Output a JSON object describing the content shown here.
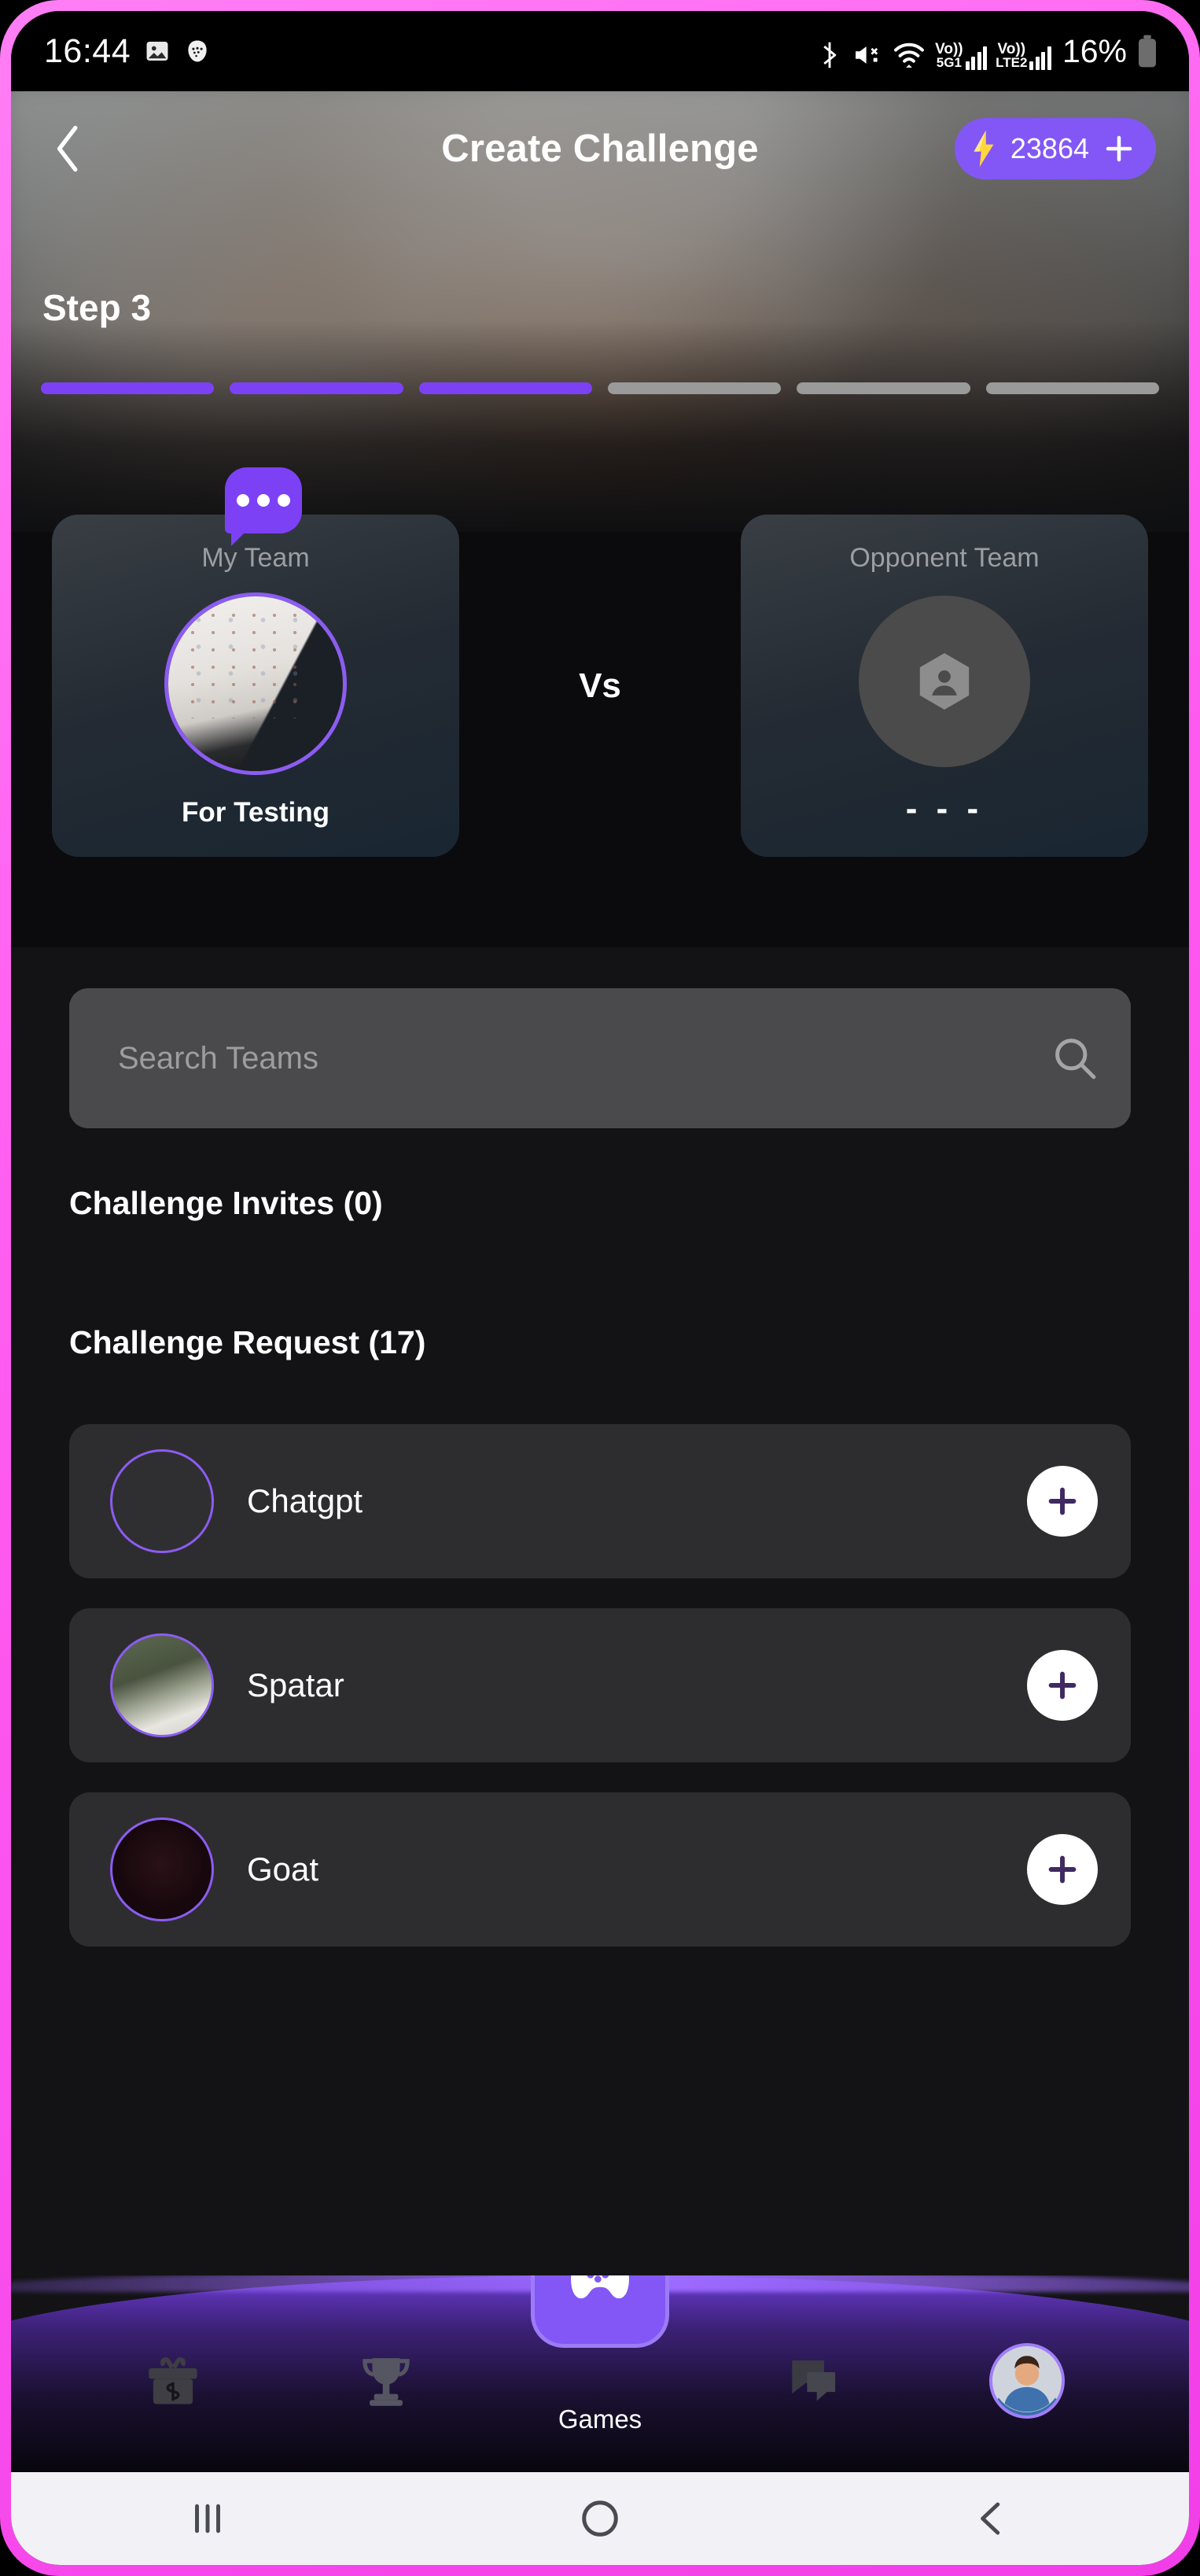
{
  "status_bar": {
    "clock": "16:44",
    "battery_percent": "16%",
    "left_icons": [
      "image-icon",
      "app-badge-icon"
    ],
    "right_icons": [
      "bluetooth-icon",
      "mute-icon",
      "wifi-icon",
      "signal-bars-icon",
      "battery-icon"
    ],
    "network_1": {
      "line1": "Vo))",
      "line2": "5G1"
    },
    "network_2": {
      "line1": "Vo))",
      "line2": "LTE2"
    }
  },
  "header": {
    "title": "Create Challenge",
    "back_icon": "chevron-left-icon",
    "coins": {
      "amount": "23864",
      "bolt_icon": "lightning-bolt-icon",
      "add_icon": "plus-icon",
      "pill_color": "#8257f5"
    }
  },
  "wizard": {
    "step_label": "Step 3",
    "total_steps": 6,
    "completed_steps": 3,
    "active_color": "#7d41f5",
    "inactive_color": "#9a9a9a"
  },
  "versus": {
    "vs_label": "Vs",
    "chat_badge_icon": "ellipsis-chat-bubble-icon",
    "my_team": {
      "label": "My Team",
      "name": "For Testing",
      "avatar": "team-photo-avatar"
    },
    "opponent_team": {
      "label": "Opponent Team",
      "name": "- - -",
      "avatar": "person-placeholder-icon"
    }
  },
  "search": {
    "placeholder": "Search Teams",
    "icon": "search-icon"
  },
  "sections": {
    "invites_heading": "Challenge Invites (0)",
    "requests_heading": "Challenge Request (17)"
  },
  "requests": [
    {
      "name": "Chatgpt",
      "avatar": "blank-avatar",
      "add_icon": "plus-icon"
    },
    {
      "name": "Spatar",
      "avatar": "cat-photo-avatar",
      "add_icon": "plus-icon"
    },
    {
      "name": "Goat",
      "avatar": "dark-photo-avatar",
      "add_icon": "plus-icon"
    }
  ],
  "bottom_nav": {
    "items": [
      {
        "label": "",
        "icon": "gift-dollar-icon"
      },
      {
        "label": "",
        "icon": "trophy-icon"
      },
      {
        "label": "",
        "icon": "chat-bubble-icon"
      },
      {
        "label": "",
        "icon": "profile-avatar-icon"
      }
    ],
    "center": {
      "label": "Games",
      "icon": "gamepad-icon"
    }
  },
  "system_nav": {
    "recents_icon": "recents-icon",
    "home_icon": "home-circle-icon",
    "back_icon": "back-chevron-icon"
  }
}
